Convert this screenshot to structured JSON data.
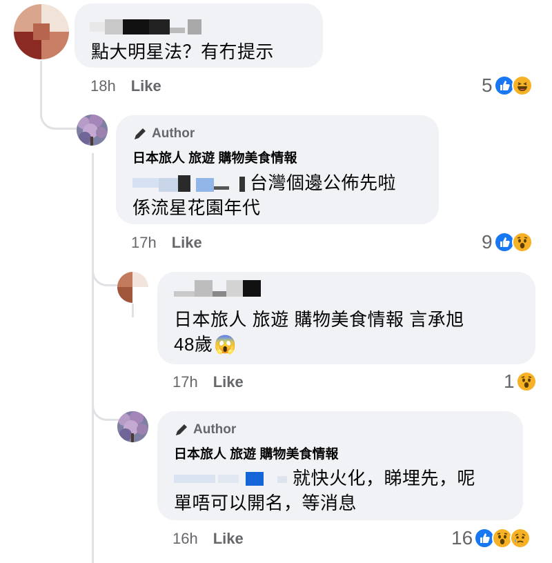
{
  "comments": [
    {
      "text": "點大明星法？有冇提示",
      "time": "18h",
      "like_label": "Like",
      "reaction_count": "5",
      "reactions": [
        "like-icon",
        "haha-icon"
      ]
    },
    {
      "badge": "Author",
      "page_name": "日本旅人  旅遊 購物美食情報",
      "line1": "台灣個邊公佈先啦",
      "line2": "係流星花園年代",
      "time": "17h",
      "like_label": "Like",
      "reaction_count": "9",
      "reactions": [
        "like-icon",
        "wow-icon"
      ]
    },
    {
      "line1": "日本旅人  旅遊 購物美食情報 言承旭",
      "line2": "48歲",
      "emoji": "😱",
      "time": "17h",
      "like_label": "Like",
      "reaction_count": "1",
      "reactions": [
        "wow-icon"
      ]
    },
    {
      "badge": "Author",
      "page_name": "日本旅人  旅遊 購物美食情報",
      "line1": "就快火化，睇埋先，呢",
      "line2": "單唔可以開名，等消息",
      "time": "16h",
      "like_label": "Like",
      "reaction_count": "16",
      "reactions": [
        "like-icon",
        "wow-icon",
        "sad-icon"
      ]
    }
  ],
  "colors": {
    "like_blue": "#1877f2",
    "emoji_yellow": "#f7b125",
    "bubble": "#f0f2f5",
    "meta": "#65676b"
  }
}
